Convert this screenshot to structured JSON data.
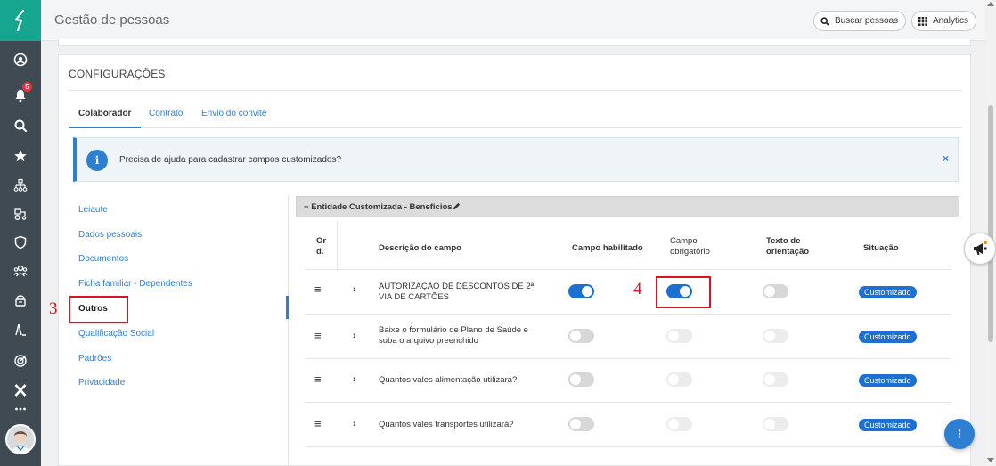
{
  "header": {
    "title": "Gestão de pessoas",
    "search_button": "Buscar pessoas",
    "analytics_button": "Analytics"
  },
  "rail": {
    "notifications_count": "5",
    "items": [
      "user-circle",
      "bell",
      "search",
      "star",
      "org-chart",
      "tractor",
      "shield",
      "team",
      "lock",
      "person-text",
      "target",
      "x-logo",
      "more"
    ]
  },
  "card": {
    "title": "CONFIGURAÇÕES",
    "tabs": [
      {
        "label": "Colaborador",
        "active": true
      },
      {
        "label": "Contrato",
        "active": false
      },
      {
        "label": "Envio do convite",
        "active": false
      }
    ],
    "info": {
      "icon_letter": "i",
      "text": "Precisa de ajuda para cadastrar campos customizados?",
      "close": "×"
    }
  },
  "side_nav": [
    {
      "label": "Leiaute",
      "active": false
    },
    {
      "label": "Dados pessoais",
      "active": false
    },
    {
      "label": "Documentos",
      "active": false
    },
    {
      "label": "Ficha familiar - Dependentes",
      "active": false
    },
    {
      "label": "Outros",
      "active": true
    },
    {
      "label": "Qualificação Social",
      "active": false
    },
    {
      "label": "Padrões",
      "active": false
    },
    {
      "label": "Privacidade",
      "active": false
    }
  ],
  "annotations": {
    "marker_3": "3",
    "marker_4": "4"
  },
  "panel": {
    "title": "Entidade Customizada - Beneficios",
    "collapse_symbol": "−",
    "columns": {
      "order_line1": "Or",
      "order_line2": "d.",
      "description": "Descrição do campo",
      "enabled": "Campo habilitado",
      "required_line1": "Campo",
      "required_line2": "obrigatório",
      "guidance_line1": "Texto de",
      "guidance_line2": "orientação",
      "status": "Situação"
    },
    "rows": [
      {
        "description_line1": "AUTORIZAÇÃO DE DESCONTOS DE 2ª",
        "description_line2": "VIA DE CARTÕES",
        "enabled": true,
        "required": true,
        "guidance": false,
        "status": "Customizado"
      },
      {
        "description_line1": "Baixe o formulário de Plano de Saúde e",
        "description_line2": "suba o arquivo preenchido",
        "enabled": false,
        "required": false,
        "guidance": false,
        "status": "Customizado"
      },
      {
        "description_line1": "Quantos vales alimentação utilizará?",
        "description_line2": "",
        "enabled": false,
        "required": false,
        "guidance": false,
        "status": "Customizado"
      },
      {
        "description_line1": "Quantos vales transportes utilizará?",
        "description_line2": "",
        "enabled": false,
        "required": false,
        "guidance": false,
        "status": "Customizado"
      }
    ]
  },
  "colors": {
    "brand_teal": "#16a58e",
    "rail_dark": "#3f4a52",
    "accent_blue": "#1d6fd1",
    "highlight_red": "#d9141e"
  }
}
